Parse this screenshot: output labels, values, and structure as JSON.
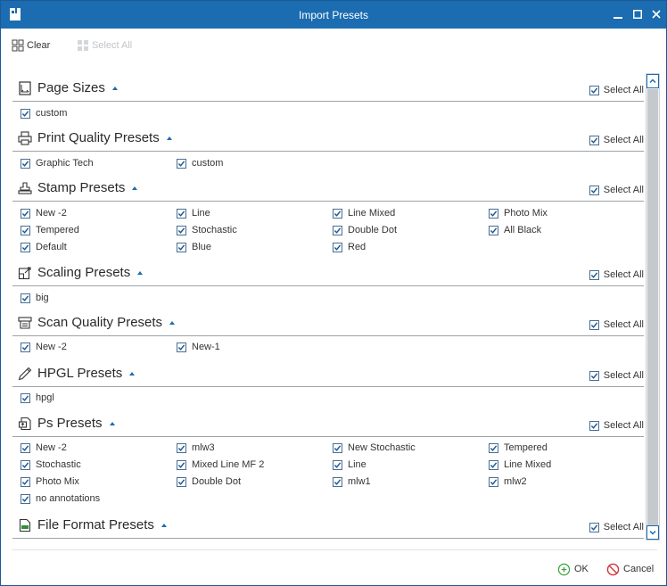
{
  "window": {
    "title": "Import Presets",
    "title_color": "#1b6cb0",
    "controls": [
      "minimize-icon",
      "maximize-icon",
      "close-icon"
    ]
  },
  "toolbar": {
    "clear_label": "Clear",
    "select_all_label": "Select All",
    "select_all_disabled": true
  },
  "select_all_label": "Select All",
  "sections": [
    {
      "title": "Page Sizes",
      "icon": "page-size-icon",
      "collapsed": false,
      "select_all_checked": true,
      "items": [
        {
          "label": "custom",
          "checked": true
        }
      ]
    },
    {
      "title": "Print Quality Presets",
      "icon": "print-quality-icon",
      "collapsed": false,
      "select_all_checked": true,
      "items": [
        {
          "label": "Graphic Tech",
          "checked": true
        },
        {
          "label": "custom",
          "checked": true
        }
      ]
    },
    {
      "title": "Stamp Presets",
      "icon": "stamp-icon",
      "collapsed": false,
      "select_all_checked": true,
      "items": [
        {
          "label": "New -2",
          "checked": true
        },
        {
          "label": "Line",
          "checked": true
        },
        {
          "label": "Line Mixed",
          "checked": true
        },
        {
          "label": "Photo Mix",
          "checked": true
        },
        {
          "label": "Tempered",
          "checked": true
        },
        {
          "label": "Stochastic",
          "checked": true
        },
        {
          "label": "Double Dot",
          "checked": true
        },
        {
          "label": "All Black",
          "checked": true
        },
        {
          "label": "Default",
          "checked": true
        },
        {
          "label": "Blue",
          "checked": true
        },
        {
          "label": "Red",
          "checked": true
        }
      ]
    },
    {
      "title": "Scaling Presets",
      "icon": "scaling-icon",
      "collapsed": false,
      "select_all_checked": true,
      "items": [
        {
          "label": "big",
          "checked": true
        }
      ]
    },
    {
      "title": "Scan Quality Presets",
      "icon": "scan-quality-icon",
      "collapsed": false,
      "select_all_checked": true,
      "items": [
        {
          "label": "New -2",
          "checked": true
        },
        {
          "label": "New-1",
          "checked": true
        }
      ]
    },
    {
      "title": "HPGL Presets",
      "icon": "pen-icon",
      "collapsed": false,
      "select_all_checked": true,
      "items": [
        {
          "label": "hpgl",
          "checked": true
        }
      ]
    },
    {
      "title": "Ps Presets",
      "icon": "ps-presets-icon",
      "collapsed": false,
      "select_all_checked": true,
      "items": [
        {
          "label": "New -2",
          "checked": true
        },
        {
          "label": "mlw3",
          "checked": true
        },
        {
          "label": "New Stochastic",
          "checked": true
        },
        {
          "label": "Tempered",
          "checked": true
        },
        {
          "label": "Stochastic",
          "checked": true
        },
        {
          "label": "Mixed Line MF 2",
          "checked": true
        },
        {
          "label": "Line",
          "checked": true
        },
        {
          "label": "Line Mixed",
          "checked": true
        },
        {
          "label": "Photo Mix",
          "checked": true
        },
        {
          "label": "Double Dot",
          "checked": true
        },
        {
          "label": "mlw1",
          "checked": true
        },
        {
          "label": "mlw2",
          "checked": true
        },
        {
          "label": "no annotations",
          "checked": true
        }
      ]
    },
    {
      "title": "File Format Presets",
      "icon": "file-format-icon",
      "collapsed": false,
      "select_all_checked": true,
      "items": []
    }
  ],
  "footer": {
    "ok_label": "OK",
    "cancel_label": "Cancel",
    "ok_color": "#3aa23a",
    "cancel_color": "#d0343c"
  }
}
